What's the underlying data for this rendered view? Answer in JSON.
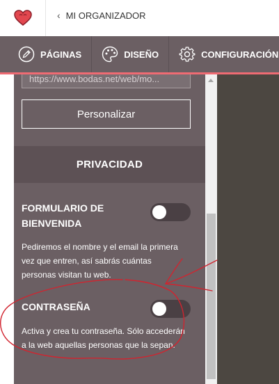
{
  "header": {
    "back_label": "MI ORGANIZADOR"
  },
  "tabs": [
    {
      "label": "PÁGINAS",
      "icon": "pencil-icon"
    },
    {
      "label": "DISEÑO",
      "icon": "palette-icon"
    },
    {
      "label": "CONFIGURACIÓN",
      "icon": "gear-icon"
    }
  ],
  "panel": {
    "url_value": "https://www.bodas.net/web/mo...",
    "customize_button": "Personalizar",
    "section_title": "PRIVACIDAD",
    "welcome_form": {
      "title_line1": "FORMULARIO DE",
      "title_line2": "BIENVENIDA",
      "enabled": false,
      "desc_line1": "Pediremos el nombre y el email la primera",
      "desc_line2": "vez que entren, así sabrás cuántas",
      "desc_line3": "personas visitan tu web."
    },
    "password": {
      "title": "CONTRASEÑA",
      "enabled": false,
      "desc_line1": "Activa y crea tu contraseña. Sólo accederán",
      "desc_line2": "a la web aquellas personas que la sepan."
    }
  },
  "colors": {
    "accent": "#ef6b73",
    "panel": "#6b5f63",
    "section_header": "#5d5155",
    "toggle_off": "#4a4044",
    "annotation": "#d1242f",
    "preview": "#4c4741"
  }
}
